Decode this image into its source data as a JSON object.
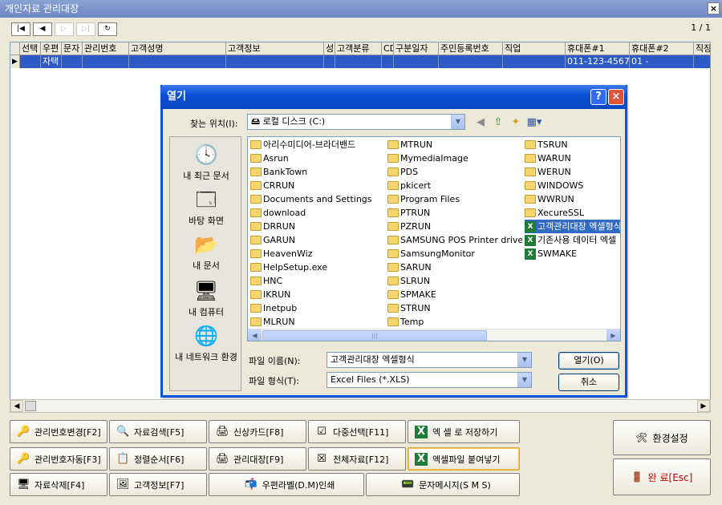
{
  "window": {
    "title": "개인자료 관리대장",
    "close_glyph": "×"
  },
  "nav": {
    "first": "|◀",
    "prev": "◀",
    "next": "▷",
    "last": "▷|",
    "refresh": "↻",
    "page_indicator": "1 / 1"
  },
  "grid": {
    "columns": [
      "선택",
      "우편",
      "문자",
      "관리번호",
      "고객성명",
      "고객정보",
      "성",
      "고객분류",
      "CD",
      "구분일자",
      "주민등록번호",
      "직업",
      "휴대폰#1",
      "휴대폰#2",
      "직장"
    ],
    "row": [
      "",
      "자택",
      "",
      "",
      "",
      "",
      "",
      "",
      "",
      "",
      "",
      "",
      "011-123-4567",
      "01 -",
      ""
    ],
    "row_indicator": "▶"
  },
  "buttons": {
    "row1": [
      "관리번호변경[F2]",
      "자료검색[F5]",
      "신상카드[F8]",
      "다중선택[F11]",
      "엑 셀 로 저장하기"
    ],
    "row2": [
      "관리번호자동[F3]",
      "정렬순서[F6]",
      "관리대장[F9]",
      "전체자료[F12]",
      "엑셀파일 붙여넣기"
    ],
    "row3": [
      "자료삭제[F4]",
      "고객정보[F7]",
      "우편라벨(D.M)인쇄",
      "문자메시지(S M S)"
    ],
    "settings": "환경설정",
    "exit": "완 료[Esc]"
  },
  "dialog": {
    "title": "열기",
    "help": "?",
    "close": "×",
    "look_in_label": "찾는 위치(I):",
    "look_in_value": "로컬 디스크 (C:)",
    "places": [
      "내 최근 문서",
      "바탕 화면",
      "내 문서",
      "내 컴퓨터",
      "내 네트워크 환경"
    ],
    "files_col1": [
      "아리수미디어-브라더밴드",
      "Asrun",
      "BankTown",
      "CRRUN",
      "Documents and Settings",
      "download",
      "DRRUN",
      "GARUN",
      "HeavenWiz",
      "HelpSetup.exe",
      "HNC",
      "IKRUN",
      "Inetpub",
      "MLRUN"
    ],
    "files_col2": [
      "MTRUN",
      "MymediaImage",
      "PDS",
      "pkicert",
      "Program Files",
      "PTRUN",
      "PZRUN",
      "SAMSUNG POS Printer driver",
      "SamsungMonitor",
      "SARUN",
      "SLRUN",
      "SPMAKE",
      "STRUN",
      "Temp"
    ],
    "files_col3": [
      "TSRUN",
      "WARUN",
      "WERUN",
      "WINDOWS",
      "WWRUN",
      "XecureSSL"
    ],
    "files_col3_xls": [
      "고객관리대장 엑셀형식",
      "기존사용 데이터 엑셀",
      "SWMAKE"
    ],
    "filename_label": "파일 이름(N):",
    "filename_value": "고객관리대장 엑셀형식",
    "filetype_label": "파일 형식(T):",
    "filetype_value": "Excel Files (*.XLS)",
    "open_button": "열기(O)",
    "cancel_button": "취소"
  },
  "colors": {
    "dialog_frame": "#0a52e0",
    "selection": "#316ac5",
    "grid_selection": "#2e5ac5"
  }
}
